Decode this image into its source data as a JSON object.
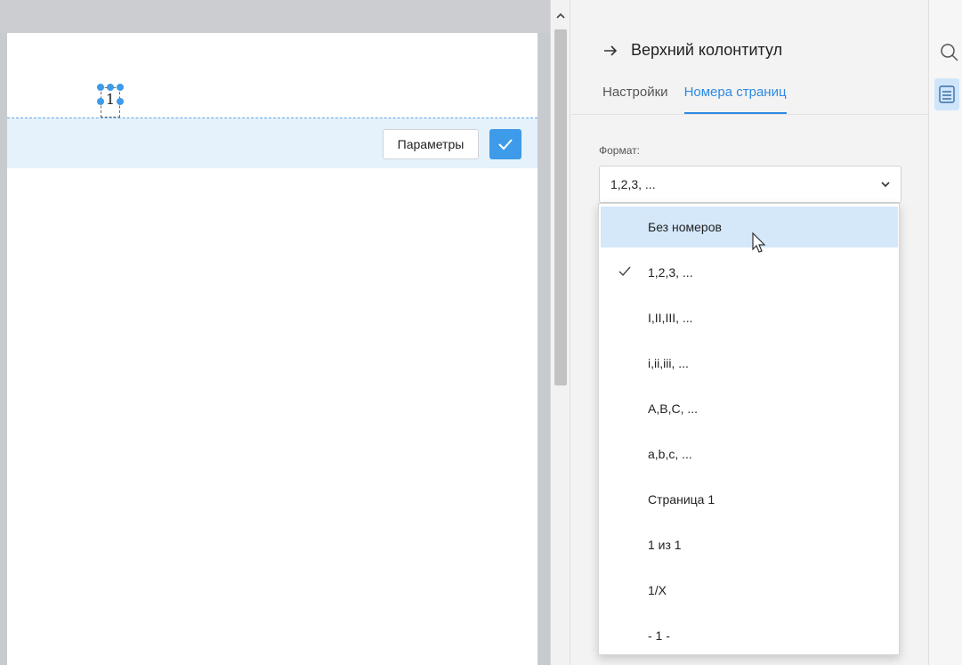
{
  "header_editor": {
    "page_number": "1",
    "params_label": "Параметры"
  },
  "panel": {
    "title": "Верхний колонтитул",
    "tabs": [
      {
        "label": "Настройки",
        "active": false
      },
      {
        "label": "Номера страниц",
        "active": true
      }
    ],
    "format_label": "Формат:",
    "format_value": "1,2,3, ..."
  },
  "dropdown": {
    "items": [
      {
        "label": "Без номеров",
        "hover": true,
        "checked": false
      },
      {
        "label": "1,2,3, ...",
        "hover": false,
        "checked": true
      },
      {
        "label": "I,II,III, ...",
        "hover": false,
        "checked": false
      },
      {
        "label": "i,ii,iii, ...",
        "hover": false,
        "checked": false
      },
      {
        "label": "A,B,C, ...",
        "hover": false,
        "checked": false
      },
      {
        "label": "a,b,c, ...",
        "hover": false,
        "checked": false
      },
      {
        "label": "Страница 1",
        "hover": false,
        "checked": false
      },
      {
        "label": "1 из 1",
        "hover": false,
        "checked": false
      },
      {
        "label": "1/X",
        "hover": false,
        "checked": false
      },
      {
        "label": "- 1 -",
        "hover": false,
        "checked": false
      }
    ]
  },
  "icons": {
    "confirm": "checkmark-icon",
    "back_arrow": "arrow-right-icon",
    "search": "search-icon",
    "document": "document-icon",
    "chevron": "chevron-down-icon"
  },
  "colors": {
    "accent": "#3d9be9",
    "hover_bg": "#d4e8fa",
    "header_bg": "#e5f1fb"
  }
}
